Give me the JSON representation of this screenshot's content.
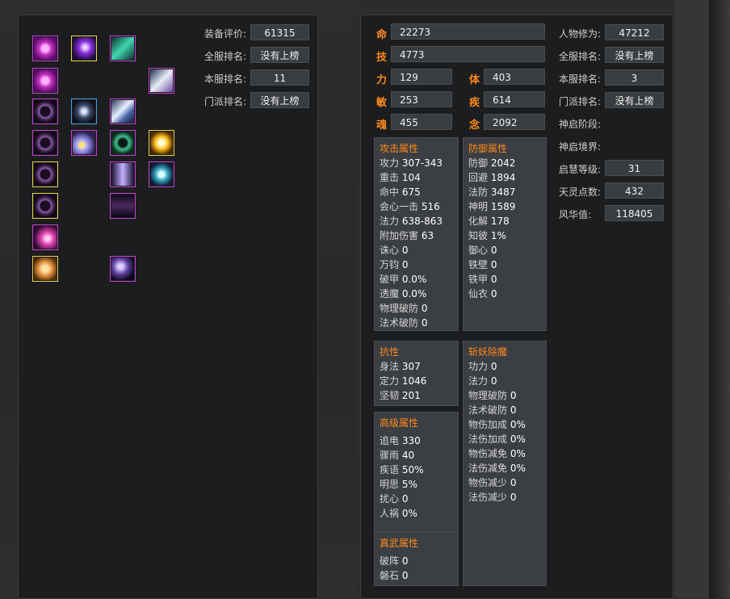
{
  "equipment_icons": [
    {
      "id": "seal-1",
      "quality": "purple",
      "icon": "purple-seal-icon"
    },
    {
      "id": "orb",
      "quality": "gold",
      "icon": "purple-orb-icon"
    },
    {
      "id": "crystal",
      "quality": "purple",
      "icon": "green-crystal-icon"
    },
    {
      "id": "seal-2",
      "quality": "purple",
      "icon": "purple-seal-icon"
    },
    {
      "id": "wing-white",
      "quality": "purple",
      "icon": "white-wing-icon"
    },
    {
      "id": "ring-1",
      "quality": "purple",
      "icon": "ring-icon"
    },
    {
      "id": "butterfly",
      "quality": "blue",
      "icon": "butterfly-icon"
    },
    {
      "id": "armor",
      "quality": "purple",
      "icon": "armor-icon"
    },
    {
      "id": "ring-2",
      "quality": "purple",
      "icon": "ring-icon"
    },
    {
      "id": "gem",
      "quality": "purple",
      "icon": "gem-icon"
    },
    {
      "id": "bracelet",
      "quality": "purple",
      "icon": "jade-bracelet-icon"
    },
    {
      "id": "sun",
      "quality": "gold",
      "icon": "sun-orb-icon"
    },
    {
      "id": "ring-3",
      "quality": "gold",
      "icon": "ring-icon"
    },
    {
      "id": "cloak",
      "quality": "purple",
      "icon": "cloak-icon"
    },
    {
      "id": "pet",
      "quality": "purple",
      "icon": "pet-icon"
    },
    {
      "id": "ring-4",
      "quality": "gold",
      "icon": "ring-icon"
    },
    {
      "id": "boots",
      "quality": "purple",
      "icon": "dark-boots-icon"
    },
    {
      "id": "pink-gem",
      "quality": "purple",
      "icon": "pink-gem-icon"
    },
    {
      "id": "token",
      "quality": "gold",
      "icon": "gold-token-icon"
    },
    {
      "id": "mirror",
      "quality": "purple",
      "icon": "mirror-icon"
    }
  ],
  "ranking": {
    "score_label": "装备评价:",
    "score_value": "61315",
    "global_label": "全服排名:",
    "global_value": "没有上榜",
    "server_label": "本服排名:",
    "server_value": "11",
    "sect_label": "门派排名:",
    "sect_value": "没有上榜"
  },
  "base": {
    "ming": {
      "label": "命",
      "value": "22273"
    },
    "ji": {
      "label": "技",
      "value": "4773"
    },
    "li": {
      "label": "力",
      "value": "129"
    },
    "ti": {
      "label": "体",
      "value": "403"
    },
    "min": {
      "label": "敏",
      "value": "253"
    },
    "ji2": {
      "label": "疾",
      "value": "614"
    },
    "hun": {
      "label": "魂",
      "value": "455"
    },
    "nian": {
      "label": "念",
      "value": "2092"
    }
  },
  "attack": {
    "title": "攻击属性",
    "rows": [
      {
        "k": "攻力",
        "v": "307-343"
      },
      {
        "k": "重击",
        "v": "104"
      },
      {
        "k": "命中",
        "v": "675"
      },
      {
        "k": "会心一击",
        "v": "516"
      },
      {
        "k": "法力",
        "v": "638-863"
      },
      {
        "k": "附加伤害",
        "v": "63"
      },
      {
        "k": "诛心",
        "v": "0"
      },
      {
        "k": "万钧",
        "v": "0"
      },
      {
        "k": "破甲",
        "v": "0.0%"
      },
      {
        "k": "透魔",
        "v": "0.0%"
      },
      {
        "k": "物理破防",
        "v": "0"
      },
      {
        "k": "法术破防",
        "v": "0"
      }
    ]
  },
  "defense": {
    "title": "防御属性",
    "rows": [
      {
        "k": "防御",
        "v": "2042"
      },
      {
        "k": "回避",
        "v": "1894"
      },
      {
        "k": "法防",
        "v": "3487"
      },
      {
        "k": "神明",
        "v": "1589"
      },
      {
        "k": "化解",
        "v": "178"
      },
      {
        "k": "知彼",
        "v": "1%"
      },
      {
        "k": "御心",
        "v": "0"
      },
      {
        "k": "铁壁",
        "v": "0"
      },
      {
        "k": "铁甲",
        "v": "0"
      },
      {
        "k": "仙衣",
        "v": "0"
      }
    ]
  },
  "resist": {
    "title": "抗性",
    "rows": [
      {
        "k": "身法",
        "v": "307"
      },
      {
        "k": "定力",
        "v": "1046"
      },
      {
        "k": "坚韧",
        "v": "201"
      }
    ]
  },
  "demon": {
    "title": "斩妖除魔",
    "rows": [
      {
        "k": "功力",
        "v": "0"
      },
      {
        "k": "法力",
        "v": "0"
      },
      {
        "k": "物理破防",
        "v": "0"
      },
      {
        "k": "法术破防",
        "v": "0"
      },
      {
        "k": "物伤加成",
        "v": "0%"
      },
      {
        "k": "法伤加成",
        "v": "0%"
      },
      {
        "k": "物伤减免",
        "v": "0%"
      },
      {
        "k": "法伤减免",
        "v": "0%"
      },
      {
        "k": "物伤减少",
        "v": "0"
      },
      {
        "k": "法伤减少",
        "v": "0"
      }
    ]
  },
  "advanced": {
    "title": "高级属性",
    "rows": [
      {
        "k": "追电",
        "v": "330"
      },
      {
        "k": "骤雨",
        "v": "40"
      },
      {
        "k": "疾语",
        "v": "50%"
      },
      {
        "k": "明思",
        "v": "5%"
      },
      {
        "k": "扰心",
        "v": "0"
      },
      {
        "k": "人祸",
        "v": "0%"
      }
    ]
  },
  "zhenwu": {
    "title": "真武属性",
    "rows": [
      {
        "k": "破阵",
        "v": "0"
      },
      {
        "k": "磐石",
        "v": "0"
      }
    ]
  },
  "character": {
    "cultivation_label": "人物修为:",
    "cultivation_value": "47212",
    "global_label": "全服排名:",
    "global_value": "没有上榜",
    "server_label": "本服排名:",
    "server_value": "3",
    "sect_label": "门派排名:",
    "sect_value": "没有上榜",
    "shenqi_stage_label": "神启阶段:",
    "shenqi_realm_label": "神启境界:",
    "wisdom_label": "启慧等级:",
    "wisdom_value": "31",
    "spirit_label": "天灵点数:",
    "spirit_value": "432",
    "fenghua_label": "风华值:",
    "fenghua_value": "118405"
  },
  "colors": {
    "accent": "#ff8a1e",
    "purple": "#c640d6",
    "gold": "#e6d24a",
    "blue": "#4aa0e0"
  }
}
